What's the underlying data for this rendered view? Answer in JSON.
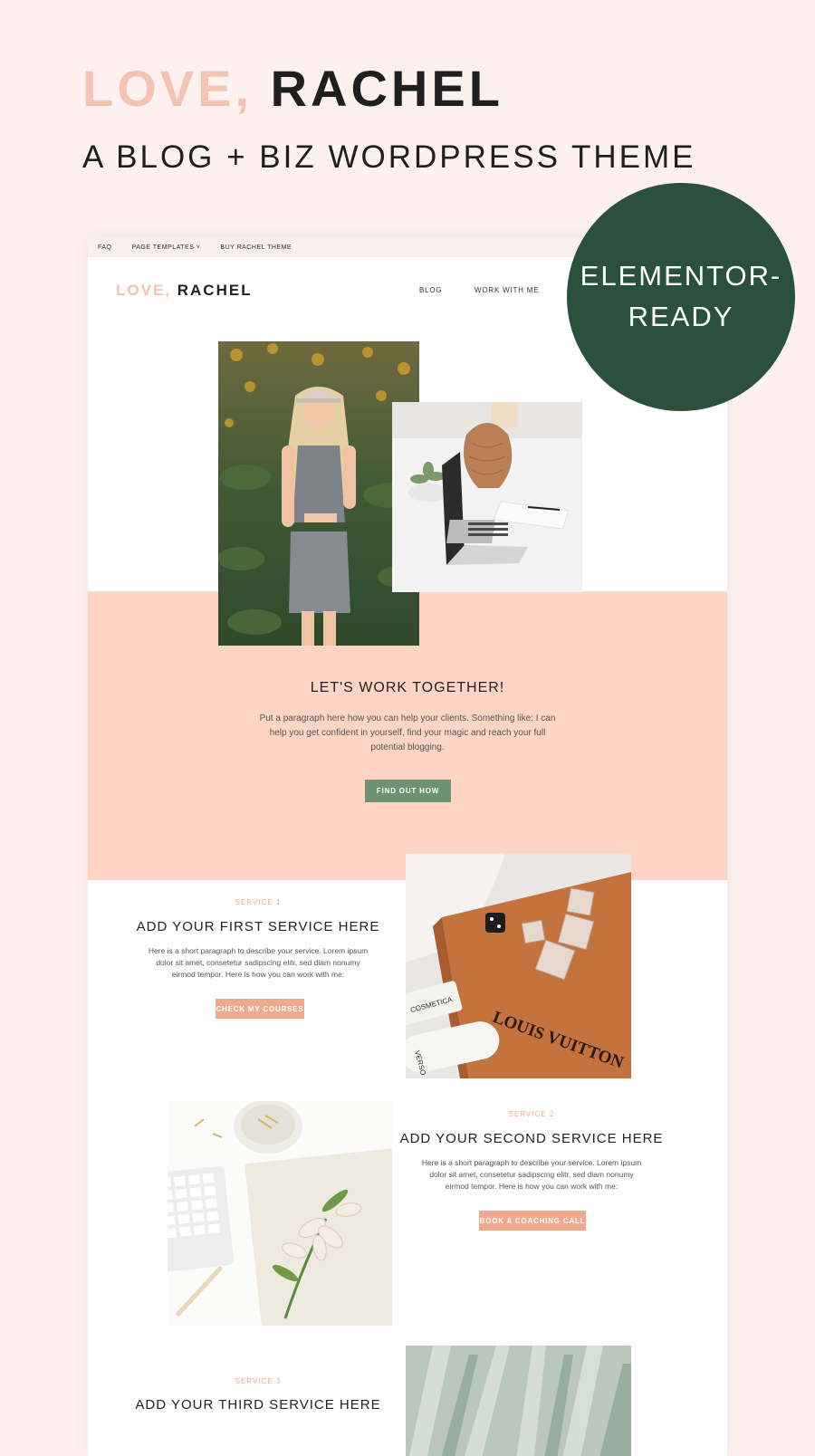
{
  "hero": {
    "title_part1": "LOVE,",
    "title_part2": "RACHEL",
    "subtitle": "A BLOG + BIZ WORDPRESS THEME"
  },
  "badge": {
    "line1": "ELEMENTOR-",
    "line2": "READY"
  },
  "site": {
    "topbar": {
      "items": [
        "FAQ",
        "PAGE TEMPLATES ˅",
        "BUY RACHEL THEME"
      ]
    },
    "logo": {
      "part1": "LOVE,",
      "part2": "RACHEL"
    },
    "nav": {
      "items": [
        "BLOG",
        "WORK WITH ME"
      ]
    },
    "work_together": {
      "title": "LET'S WORK TOGETHER!",
      "text": "Put a paragraph here how you can help your clients. Something like: I can help you get confident in yourself, find your magic and reach your full potential blogging.",
      "button": "FIND OUT HOW"
    },
    "services": [
      {
        "label": "SERVICE 1",
        "title": "ADD YOUR FIRST SERVICE HERE",
        "text": "Here is a short paragraph to describe your service. Lorem ipsum dolor sit amet, consetetur sadipscing elitr, sed diam nonumy eirmod tempor. Here is how you can work with me:",
        "button": "CHECK MY COURSES"
      },
      {
        "label": "SERVICE 2",
        "title": "ADD YOUR SECOND SERVICE HERE",
        "text": "Here is a short paragraph to describe your service. Lorem ipsum dolor sit amet, consetetur sadipscing elitr, sed diam nonumy eirmod tempor. Here is how you can work with me:",
        "button": "BOOK A COACHING CALL"
      },
      {
        "label": "SERVICE 3",
        "title": "ADD YOUR THIRD SERVICE HERE"
      }
    ],
    "photo_texts": {
      "book": "LOUIS VUITTON",
      "cosmetic": "COSMETICA",
      "verso": "VERSO"
    }
  },
  "colors": {
    "page_bg": "#fcf1ee",
    "accent_pink": "#f4c3b2",
    "peach_band": "#fed4c4",
    "badge_green": "#2b513d",
    "button_green": "#6e9174",
    "button_peach": "#efa98d"
  }
}
